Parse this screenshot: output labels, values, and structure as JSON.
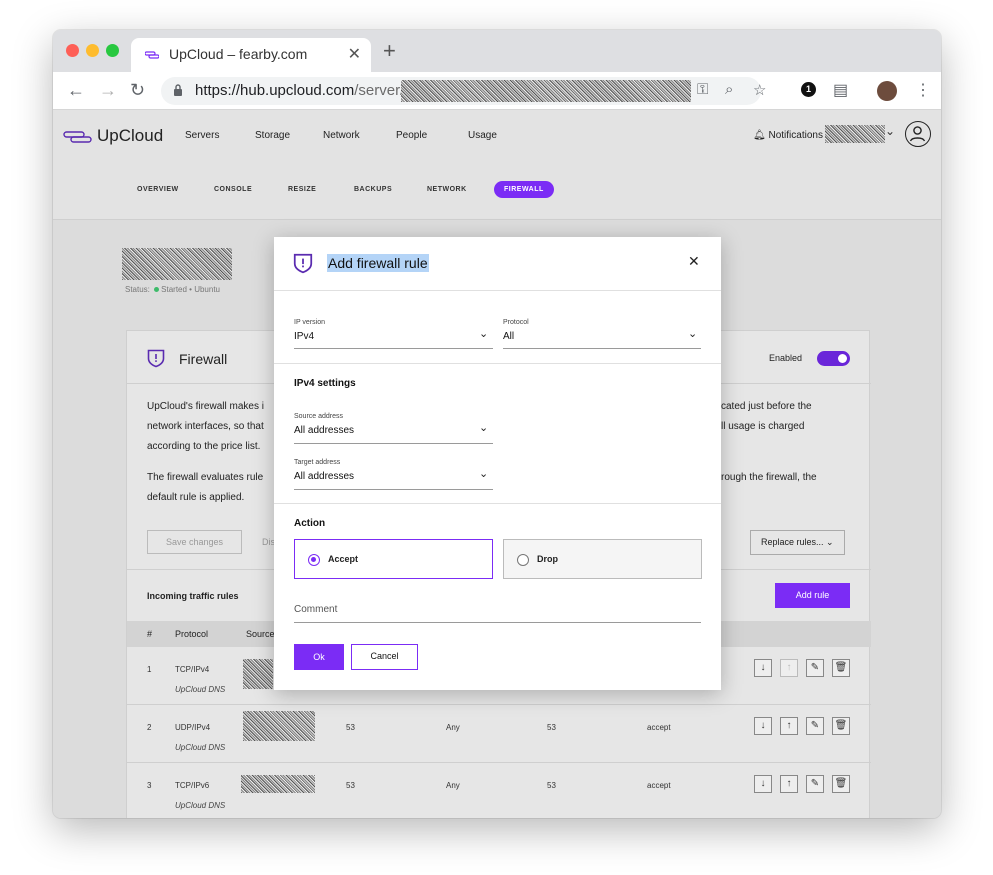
{
  "browser": {
    "tab_title": "UpCloud – fearby.com",
    "close_glyph": "✕",
    "new_tab_glyph": "+",
    "url_host": "https://hub.upcloud.com",
    "url_path": "/server/",
    "ext_badge": "1"
  },
  "header": {
    "logo_text": "UpCloud",
    "nav": [
      "Servers",
      "Storage",
      "Network",
      "People",
      "Usage"
    ],
    "notifications_label": "Notifications"
  },
  "subnav": [
    "OVERVIEW",
    "CONSOLE",
    "RESIZE",
    "BACKUPS",
    "NETWORK",
    "FIREWALL"
  ],
  "server": {
    "status_prefix": "Status:",
    "status_value": "Started",
    "os": "Ubuntu"
  },
  "firewall_card": {
    "title": "Firewall",
    "enabled_label": "Enabled",
    "para1_a": "UpCloud's firewall makes i",
    "para1_b": "network interfaces, so that",
    "para1_c": "according to the price list.",
    "para1_r1": "cated just before the",
    "para1_r2": "ll usage is charged",
    "para2_a": "The firewall evaluates rule",
    "para2_b": "default rule is applied.",
    "para2_r1": "rough the firewall, the",
    "save_changes": "Save changes",
    "discard_partial": "Dis",
    "replace_rules": "Replace rules...",
    "incoming_label": "Incoming traffic rules",
    "add_rule": "Add rule",
    "columns": [
      "#",
      "Protocol",
      "Source"
    ],
    "rows": [
      {
        "num": "1",
        "protocol": "TCP/IPv4",
        "comment": "UpCloud DNS",
        "port": "",
        "any": "",
        "dport": "",
        "action": ""
      },
      {
        "num": "2",
        "protocol": "UDP/IPv4",
        "comment": "UpCloud DNS",
        "port": "53",
        "any": "Any",
        "dport": "53",
        "action": "accept"
      },
      {
        "num": "3",
        "protocol": "TCP/IPv6",
        "comment": "UpCloud DNS",
        "port": "53",
        "any": "Any",
        "dport": "53",
        "action": "accept"
      }
    ]
  },
  "modal": {
    "title": "Add firewall rule",
    "close_glyph": "✕",
    "ip_version_label": "IP version",
    "ip_version_value": "IPv4",
    "protocol_label": "Protocol",
    "protocol_value": "All",
    "settings_heading": "IPv4 settings",
    "source_label": "Source address",
    "source_value": "All addresses",
    "target_label": "Target address",
    "target_value": "All addresses",
    "action_heading": "Action",
    "accept_label": "Accept",
    "drop_label": "Drop",
    "comment_placeholder": "Comment",
    "ok_label": "Ok",
    "cancel_label": "Cancel"
  },
  "icons": {
    "shield": "shield-icon",
    "bell": "bell-icon",
    "key": "key-icon",
    "zoom": "zoom-icon",
    "star": "star-icon",
    "lock": "lock-icon"
  },
  "colors": {
    "accent": "#7b2cf5",
    "toggle": "#6a26d9",
    "status_green": "#3dbb6a"
  }
}
